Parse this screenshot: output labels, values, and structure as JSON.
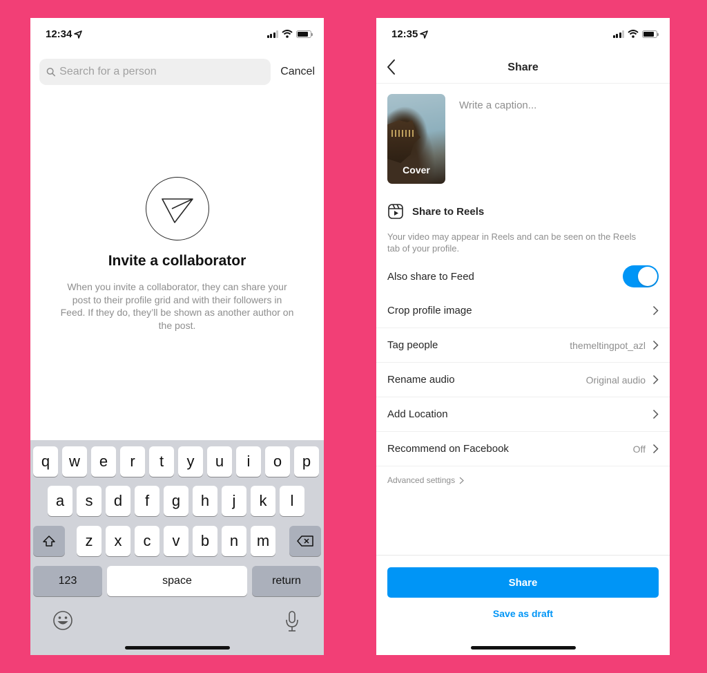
{
  "background_color": "#f23f76",
  "accent_color": "#0095f6",
  "left_screen": {
    "status_bar": {
      "time": "12:34"
    },
    "search": {
      "placeholder": "Search for a person",
      "value": ""
    },
    "cancel_label": "Cancel",
    "empty_state": {
      "icon": "send-icon",
      "title": "Invite a collaborator",
      "description": "When you invite a collaborator, they can share your post to their profile grid and with their followers in Feed. If they do, they’ll be shown as another author on the post."
    },
    "keyboard": {
      "row1": [
        "q",
        "w",
        "e",
        "r",
        "t",
        "y",
        "u",
        "i",
        "o",
        "p"
      ],
      "row2": [
        "a",
        "s",
        "d",
        "f",
        "g",
        "h",
        "j",
        "k",
        "l"
      ],
      "row3": [
        "z",
        "x",
        "c",
        "v",
        "b",
        "n",
        "m"
      ],
      "numbers_label": "123",
      "space_label": "space",
      "return_label": "return"
    }
  },
  "right_screen": {
    "status_bar": {
      "time": "12:35"
    },
    "header": {
      "title": "Share"
    },
    "cover_label": "Cover",
    "caption": {
      "placeholder": "Write a caption...",
      "value": ""
    },
    "reels": {
      "title": "Share to Reels",
      "description": "Your video may appear in Reels and can be seen on the Reels tab of your profile."
    },
    "also_share_feed": {
      "label": "Also share to Feed",
      "enabled": true
    },
    "settings": [
      {
        "label": "Crop profile image",
        "value": ""
      },
      {
        "label": "Tag people",
        "value": "themeltingpot_azl"
      },
      {
        "label": "Rename audio",
        "value": "Original audio"
      },
      {
        "label": "Add Location",
        "value": ""
      },
      {
        "label": "Recommend on Facebook",
        "value": "Off"
      }
    ],
    "advanced_label": "Advanced settings",
    "share_button": "Share",
    "save_draft": "Save as draft"
  }
}
